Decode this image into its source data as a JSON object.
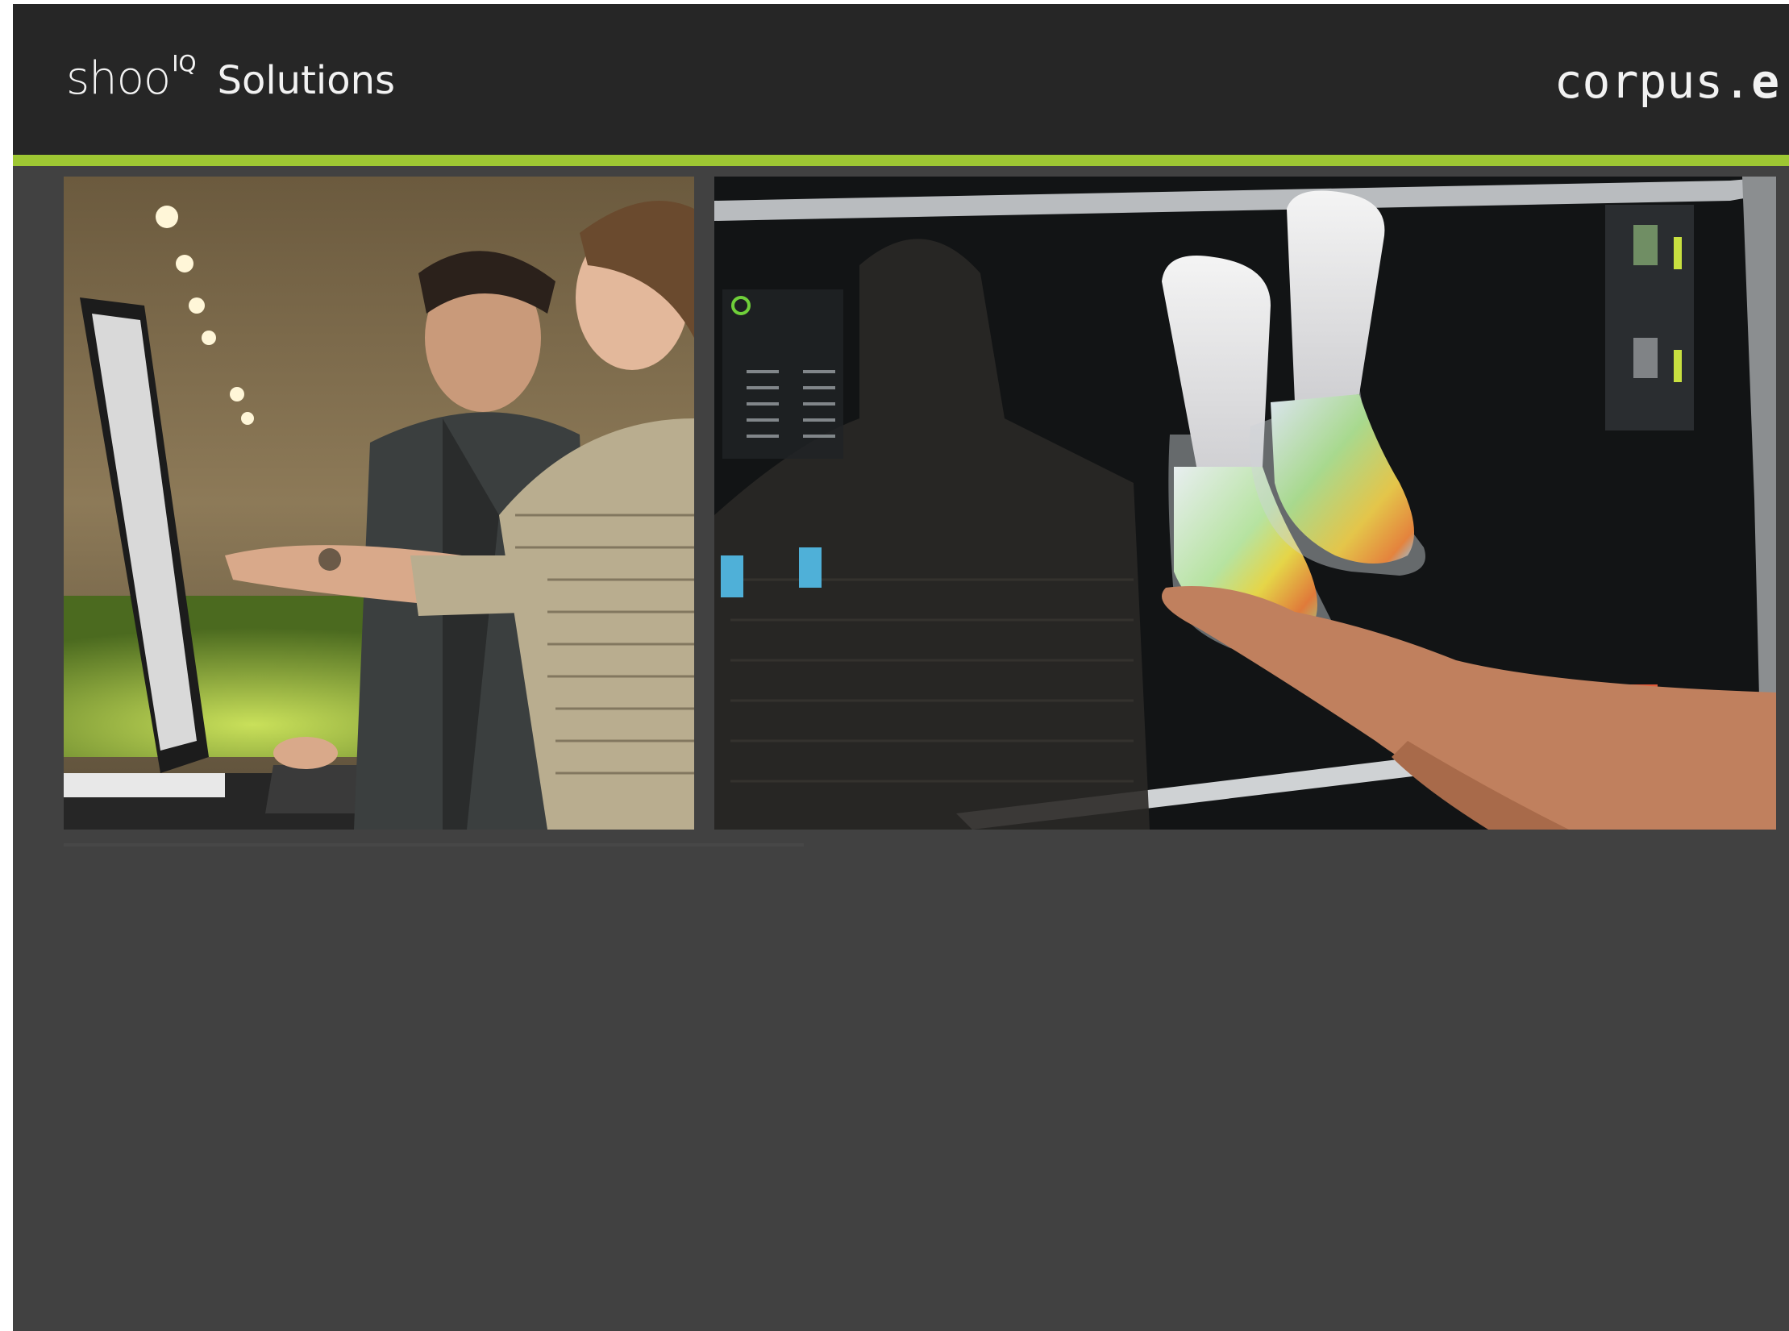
{
  "header": {
    "logo_word": "shoo",
    "logo_superscript": "IQ",
    "logo_subtitle": "Solutions",
    "brand_prefix": "corpus.",
    "brand_suffix": "e"
  },
  "photos": [
    {
      "name": "people-at-workstation",
      "description_icon": "photo-icon"
    },
    {
      "name": "3d-foot-scan-screen",
      "description_icon": "photo-icon"
    }
  ],
  "colors": {
    "header_bg": "#262626",
    "accent": "#9ec733",
    "slide_bg": "#414141"
  }
}
